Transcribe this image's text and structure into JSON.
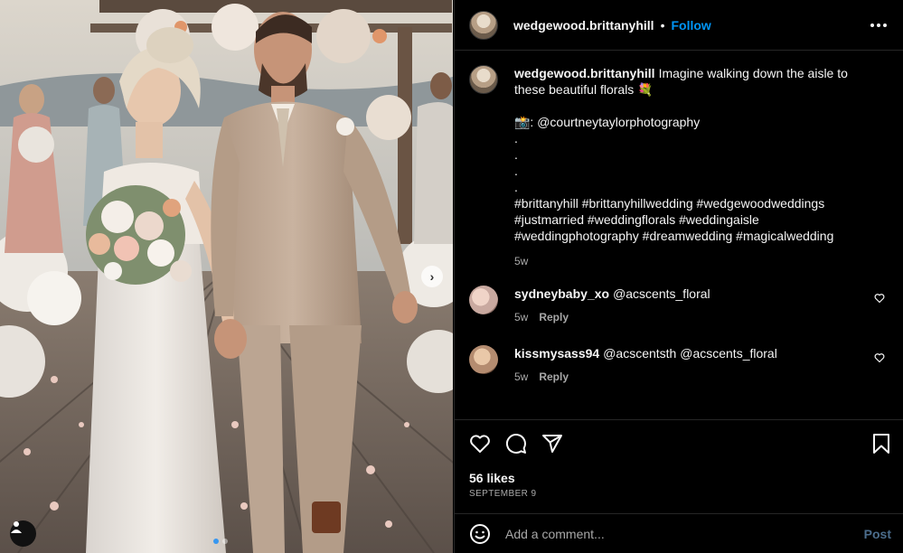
{
  "post": {
    "username": "wedgewood.brittanyhill",
    "separator": "•",
    "follow_label": "Follow",
    "more_label": "•••"
  },
  "photo": {
    "next_label": "›",
    "slide_count": 2,
    "active_slide": 1
  },
  "caption": {
    "username": "wedgewood.brittanyhill",
    "text_line": "Imagine walking down the aisle to these beautiful florals 💐",
    "credit": "📸: @courtneytaylorphotography",
    "dots": [
      ".",
      ".",
      ".",
      "."
    ],
    "hashtags": "#brittanyhill #brittanyhillwedding #wedgewoodweddings #justmarried #weddingflorals #weddingaisle #weddingphotography #dreamwedding #magicalwedding",
    "time": "5w"
  },
  "comments": [
    {
      "username": "sydneybaby_xo",
      "text": "@acscents_floral",
      "time": "5w",
      "reply_label": "Reply",
      "avatar_color": "#c9a9a0"
    },
    {
      "username": "kissmysass94",
      "text": "@acscentsth @acscents_floral",
      "time": "5w",
      "reply_label": "Reply",
      "avatar_color": "#b48c70"
    }
  ],
  "actions": {
    "likes": "56 likes",
    "date": "SEPTEMBER 9"
  },
  "add_comment": {
    "placeholder": "Add a comment...",
    "post_label": "Post"
  },
  "icons": {
    "like": "heart-icon",
    "comment": "comment-icon",
    "share": "share-icon",
    "save": "bookmark-icon",
    "emoji": "emoji-icon",
    "more": "more-icon",
    "user_tag": "user-icon",
    "comment_like": "heart-icon"
  },
  "colors": {
    "accent": "#0095f6",
    "background": "#000000",
    "text": "#f5f5f5",
    "muted": "#a8a8a8",
    "post_disabled": "#4b6d8c"
  }
}
